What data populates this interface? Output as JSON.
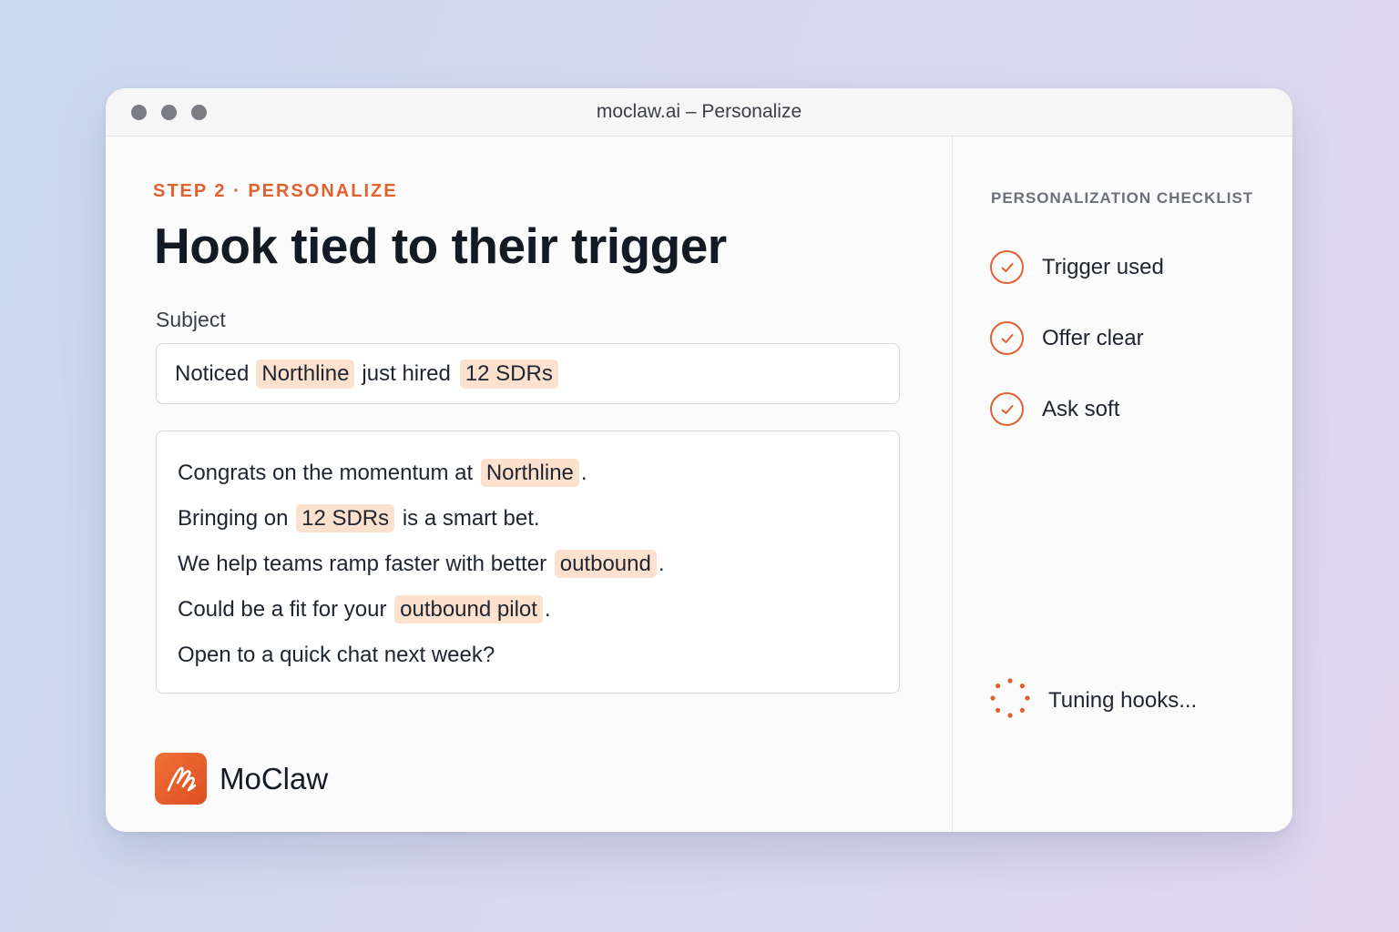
{
  "window": {
    "title": "moclaw.ai – Personalize"
  },
  "main": {
    "step_label": "STEP 2 · PERSONALIZE",
    "headline": "Hook tied to their trigger",
    "subject_label": "Subject",
    "subject": {
      "text_1": "Noticed",
      "token_1": "Northline",
      "text_2": "just hired",
      "token_2": "12 SDRs"
    },
    "body": [
      {
        "before": "Congrats on the momentum at",
        "token": "Northline",
        "after": "."
      },
      {
        "before": "Bringing on",
        "token": "12 SDRs",
        "after": "is a smart bet."
      },
      {
        "before": "We help teams ramp faster with better",
        "token": "outbound",
        "after": "."
      },
      {
        "before": "Could be a fit for your",
        "token": "outbound pilot",
        "after": "."
      },
      {
        "before": "Open to a quick chat next week?",
        "token": "",
        "after": ""
      }
    ],
    "highlight_color": "#fde1cf"
  },
  "brand": {
    "name": "MoClaw",
    "logo_icon": "moclaw-logo-icon",
    "color": "#e65a2a"
  },
  "sidebar": {
    "checklist_title": "PERSONALIZATION CHECKLIST",
    "items": [
      {
        "label": "Trigger used",
        "icon": "check-circle-icon",
        "checked": true
      },
      {
        "label": "Offer clear",
        "icon": "check-circle-icon",
        "checked": true
      },
      {
        "label": "Ask soft",
        "icon": "check-circle-icon",
        "checked": true
      }
    ],
    "status": {
      "label": "Tuning hooks...",
      "icon": "spinner-icon"
    },
    "accent_color": "#e0602e"
  }
}
